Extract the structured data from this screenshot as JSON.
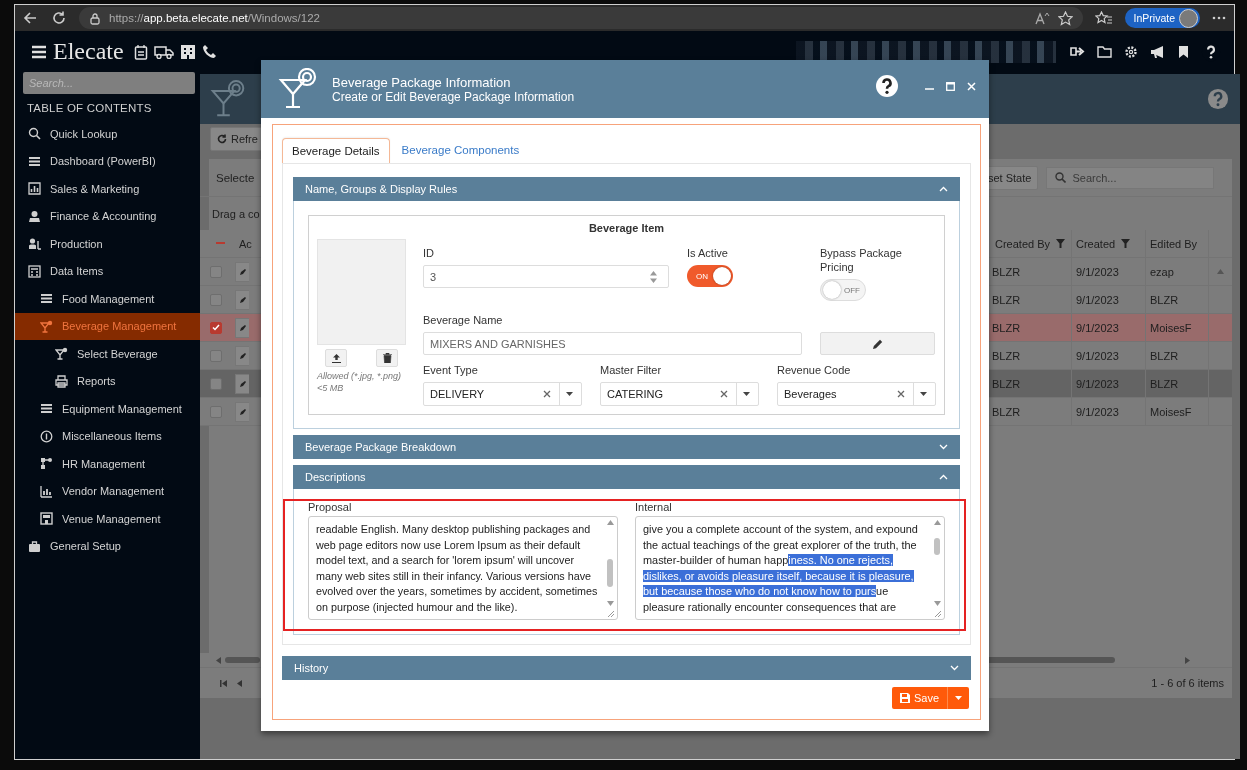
{
  "browser": {
    "url": "https://**app.beta.elecate.net**/Windows/122",
    "inprivate_label": "InPrivate"
  },
  "app_header": {
    "logo": "Elecate"
  },
  "sidebar": {
    "search_placeholder": "Search...",
    "heading": "TABLE OF CONTENTS",
    "items": [
      {
        "label": "Quick Lookup",
        "selected": false
      },
      {
        "label": "Dashboard (PowerBI)",
        "selected": false
      },
      {
        "label": "Sales & Marketing",
        "selected": false
      },
      {
        "label": "Finance & Accounting",
        "selected": false
      },
      {
        "label": "Production",
        "selected": false
      },
      {
        "label": "Data Items",
        "selected": false,
        "children": [
          {
            "label": "Food Management",
            "selected": false
          },
          {
            "label": "Beverage Management",
            "selected": true,
            "children": [
              {
                "label": "Select Beverage",
                "selected": false
              },
              {
                "label": "Reports",
                "selected": false
              }
            ]
          },
          {
            "label": "Equipment Management",
            "selected": false
          },
          {
            "label": "Miscellaneous Items",
            "selected": false
          },
          {
            "label": "HR Management",
            "selected": false
          },
          {
            "label": "Vendor Management",
            "selected": false
          },
          {
            "label": "Venue Management",
            "selected": false
          }
        ]
      },
      {
        "label": "General Setup",
        "selected": false
      }
    ]
  },
  "grid": {
    "refresh_label": "Refre",
    "selected_label": "Selecte",
    "reset_state_label": "set State",
    "search_placeholder": "Search...",
    "group_hint": "Drag a co",
    "columns": [
      "Ac",
      "Created By",
      "Created",
      "Edited By"
    ],
    "rows": [
      {
        "selected": false,
        "hovered": false,
        "created_by": "BLZR",
        "created": "9/1/2023",
        "edited_by": "ezap"
      },
      {
        "selected": false,
        "hovered": false,
        "created_by": "BLZR",
        "created": "9/1/2023",
        "edited_by": "BLZR"
      },
      {
        "selected": true,
        "hovered": false,
        "created_by": "BLZR",
        "created": "9/1/2023",
        "edited_by": "MoisesF"
      },
      {
        "selected": false,
        "hovered": false,
        "created_by": "BLZR",
        "created": "9/1/2023",
        "edited_by": "BLZR"
      },
      {
        "selected": false,
        "hovered": true,
        "created_by": "BLZR",
        "created": "9/1/2023",
        "edited_by": "BLZR"
      },
      {
        "selected": false,
        "hovered": false,
        "created_by": "BLZR",
        "created": "9/1/2023",
        "edited_by": "MoisesF"
      }
    ],
    "pager": "1 - 6 of 6 items"
  },
  "dialog": {
    "title": "Beverage Package Information",
    "subtitle": "Create or Edit Beverage Package Information",
    "tabs": [
      {
        "label": "Beverage Details",
        "selected": true
      },
      {
        "label": "Beverage Components",
        "selected": false
      }
    ],
    "panels": [
      {
        "kind": "item",
        "title": "Name, Groups & Display Rules",
        "expanded": true
      },
      {
        "kind": "breakdown",
        "title": "Beverage Package Breakdown",
        "expanded": false
      },
      {
        "kind": "descriptions",
        "title": "Descriptions",
        "expanded": true
      },
      {
        "kind": "history",
        "title": "History",
        "expanded": false
      }
    ],
    "item": {
      "legend": "Beverage Item",
      "image_hint": "Allowed (*.jpg, *.png) <5 MB",
      "id": {
        "label": "ID",
        "value": "3"
      },
      "is_active": {
        "label": "Is Active",
        "on": true,
        "state_text": "ON"
      },
      "bypass": {
        "label": "Bypass Package Pricing",
        "on": false,
        "state_text": "OFF"
      },
      "name": {
        "label": "Beverage Name",
        "value": "MIXERS AND GARNISHES"
      },
      "selects": [
        {
          "label": "Event Type",
          "value": "DELIVERY"
        },
        {
          "label": "Master Filter",
          "value": "CATERING"
        },
        {
          "label": "Revenue Code",
          "value": "Beverages"
        }
      ]
    },
    "descriptions": {
      "proposal": {
        "label": "Proposal",
        "text": "readable English. Many desktop publishing packages and web page editors now use Lorem Ipsum as their default model text, and a search for 'lorem ipsum' will uncover many web sites still in their infancy. Various versions have evolved over the years, sometimes by accident, sometimes on purpose (injected humour and the like)."
      },
      "internal": {
        "label": "Internal",
        "text_before": "give you a complete account of the system, and expound the actual teachings of the great explorer of the truth, the master-builder of human happ",
        "selected_text": "iness. No one rejects, dislikes, or avoids pleasure itself, because it is pleasure, but because those who do not know how to purs",
        "text_after": "ue pleasure rationally encounter consequences that are"
      }
    },
    "save_label": "Save"
  }
}
